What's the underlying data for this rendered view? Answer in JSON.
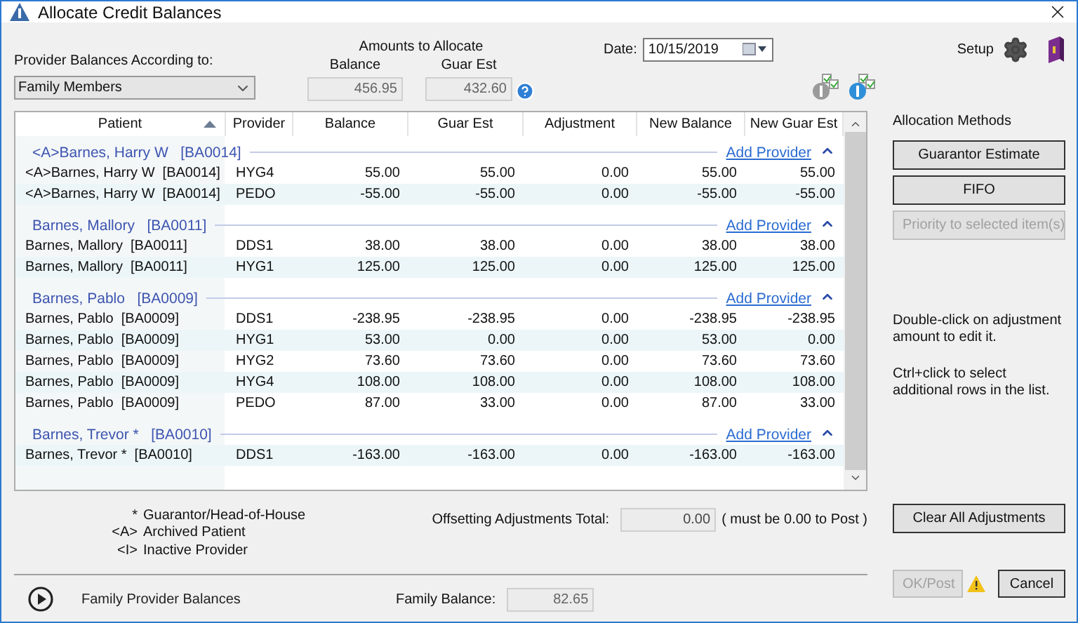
{
  "window": {
    "title": "Allocate Credit Balances"
  },
  "provider_balances": {
    "label": "Provider Balances According to:",
    "value": "Family Members"
  },
  "amounts": {
    "title": "Amounts to Allocate",
    "balance_label": "Balance",
    "balance": "456.95",
    "guar_label": "Guar Est",
    "guar": "432.60"
  },
  "date": {
    "label": "Date:",
    "value": "10/15/2019"
  },
  "setup": {
    "label": "Setup"
  },
  "table": {
    "columns": [
      {
        "label": "Patient",
        "sorted": true
      },
      {
        "label": "Provider",
        "sorted": false
      },
      {
        "label": "Balance",
        "sorted": false
      },
      {
        "label": "Guar Est",
        "sorted": false
      },
      {
        "label": "Adjustment",
        "sorted": false
      },
      {
        "label": "New Balance",
        "sorted": false
      },
      {
        "label": "New Guar Est",
        "sorted": false
      }
    ],
    "groups": [
      {
        "name": "<A>Barnes, Harry W",
        "account": "[BA0014]",
        "link": "Add Provider",
        "expanded": true,
        "rows": [
          {
            "patient": "<A>Barnes, Harry W  [BA0014]",
            "provider": "HYG4",
            "balance": "55.00",
            "guar_est": "55.00",
            "adjustment": "0.00",
            "new_balance": "55.00",
            "new_guar_est": "55.00"
          },
          {
            "patient": "<A>Barnes, Harry W  [BA0014]",
            "provider": "PEDO",
            "balance": "-55.00",
            "guar_est": "-55.00",
            "adjustment": "0.00",
            "new_balance": "-55.00",
            "new_guar_est": "-55.00"
          }
        ]
      },
      {
        "name": "Barnes, Mallory",
        "account": "[BA0011]",
        "link": "Add Provider",
        "expanded": true,
        "rows": [
          {
            "patient": "Barnes, Mallory  [BA0011]",
            "provider": "DDS1",
            "balance": "38.00",
            "guar_est": "38.00",
            "adjustment": "0.00",
            "new_balance": "38.00",
            "new_guar_est": "38.00"
          },
          {
            "patient": "Barnes, Mallory  [BA0011]",
            "provider": "HYG1",
            "balance": "125.00",
            "guar_est": "125.00",
            "adjustment": "0.00",
            "new_balance": "125.00",
            "new_guar_est": "125.00"
          }
        ]
      },
      {
        "name": "Barnes, Pablo",
        "account": "[BA0009]",
        "link": "Add Provider",
        "expanded": true,
        "rows": [
          {
            "patient": "Barnes, Pablo  [BA0009]",
            "provider": "DDS1",
            "balance": "-238.95",
            "guar_est": "-238.95",
            "adjustment": "0.00",
            "new_balance": "-238.95",
            "new_guar_est": "-238.95"
          },
          {
            "patient": "Barnes, Pablo  [BA0009]",
            "provider": "HYG1",
            "balance": "53.00",
            "guar_est": "0.00",
            "adjustment": "0.00",
            "new_balance": "53.00",
            "new_guar_est": "0.00"
          },
          {
            "patient": "Barnes, Pablo  [BA0009]",
            "provider": "HYG2",
            "balance": "73.60",
            "guar_est": "73.60",
            "adjustment": "0.00",
            "new_balance": "73.60",
            "new_guar_est": "73.60"
          },
          {
            "patient": "Barnes, Pablo  [BA0009]",
            "provider": "HYG4",
            "balance": "108.00",
            "guar_est": "108.00",
            "adjustment": "0.00",
            "new_balance": "108.00",
            "new_guar_est": "108.00"
          },
          {
            "patient": "Barnes, Pablo  [BA0009]",
            "provider": "PEDO",
            "balance": "87.00",
            "guar_est": "33.00",
            "adjustment": "0.00",
            "new_balance": "87.00",
            "new_guar_est": "33.00"
          }
        ]
      },
      {
        "name": "Barnes, Trevor *",
        "account": "[BA0010]",
        "link": "Add Provider",
        "expanded": true,
        "rows": [
          {
            "patient": "Barnes, Trevor *  [BA0010]",
            "provider": "DDS1",
            "balance": "-163.00",
            "guar_est": "-163.00",
            "adjustment": "0.00",
            "new_balance": "-163.00",
            "new_guar_est": "-163.00"
          }
        ]
      }
    ]
  },
  "allocation": {
    "title": "Allocation Methods",
    "buttons": [
      {
        "label": "Guarantor Estimate",
        "disabled": false
      },
      {
        "label": "FIFO",
        "disabled": false
      },
      {
        "label": "Priority to selected item(s)",
        "disabled": true
      }
    ]
  },
  "notes": [
    "Double-click on adjustment amount to edit it.",
    "Ctrl+click to select additional rows in the list."
  ],
  "legend": [
    {
      "symbol": "*",
      "text": "Guarantor/Head-of-House"
    },
    {
      "symbol": "<A>",
      "text": "Archived Patient"
    },
    {
      "symbol": "<I>",
      "text": "Inactive Provider"
    }
  ],
  "offsetting": {
    "label": "Offsetting Adjustments Total:",
    "value": "0.00",
    "note": "( must be 0.00 to Post )"
  },
  "clear_button": {
    "label": "Clear All Adjustments",
    "disabled": false
  },
  "footer": {
    "link": "Family Provider Balances",
    "balance_label": "Family Balance:",
    "balance": "82.65"
  },
  "ok_button": {
    "label": "OK/Post",
    "disabled": true
  },
  "cancel_button": {
    "label": "Cancel",
    "disabled": false
  }
}
